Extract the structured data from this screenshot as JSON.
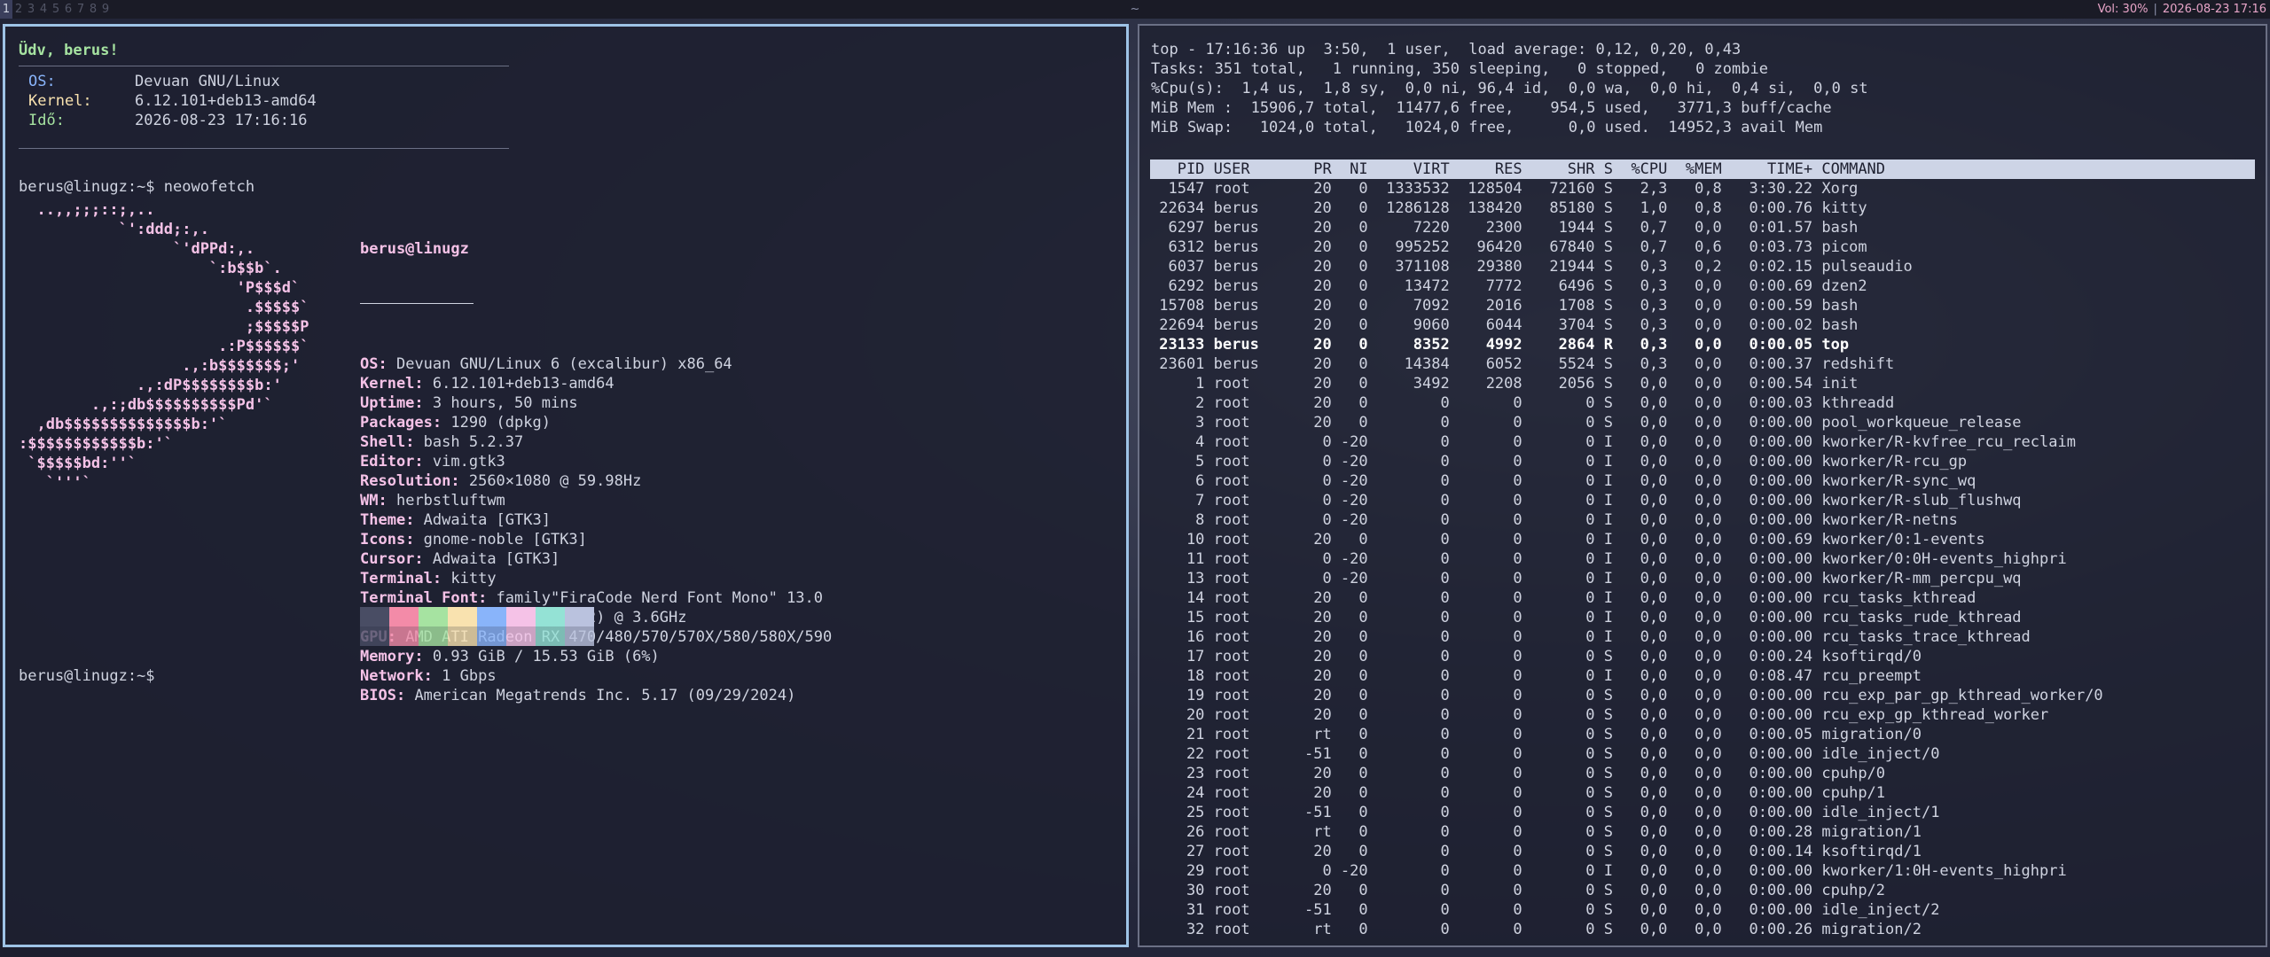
{
  "bar": {
    "tags": [
      "1",
      "2",
      "3",
      "4",
      "5",
      "6",
      "7",
      "8",
      "9"
    ],
    "active_tag": "1",
    "center": "~",
    "volume": "Vol: 30%",
    "separator": "|",
    "datetime": "2026-08-23 17:16"
  },
  "left": {
    "greeting": "Üdv, berus!",
    "sysinfo": [
      {
        "label": "OS:",
        "value": "Devuan GNU/Linux"
      },
      {
        "label": "Kernel:",
        "value": "6.12.101+deb13-amd64"
      },
      {
        "label": "Idő:",
        "value": "2026-08-23 17:16:16"
      }
    ],
    "prompt1": "berus@linugz:~$ neowofetch",
    "prompt2": "berus@linugz:~$",
    "ascii": "  ..,,;;;::;,..\n           `':ddd;:,.\n                 `'dPPd:,.\n                     `:b$$b`.\n                        'P$$$d`\n                         .$$$$$`\n                         ;$$$$$P\n                      .:P$$$$$$`\n                  .,:b$$$$$$$;'\n             .,:dP$$$$$$$$b:'\n        .,:;db$$$$$$$$$$Pd'`\n  ,db$$$$$$$$$$$$$$b:'`\n:$$$$$$$$$$$$b:'`\n `$$$$$bd:''`\n   `'''`",
    "neofetch": {
      "title": "berus@linugz",
      "fields": [
        {
          "key": "OS",
          "value": "Devuan GNU/Linux 6 (excalibur) x86_64"
        },
        {
          "key": "Kernel",
          "value": "6.12.101+deb13-amd64"
        },
        {
          "key": "Uptime",
          "value": "3 hours, 50 mins"
        },
        {
          "key": "Packages",
          "value": "1290 (dpkg)"
        },
        {
          "key": "Shell",
          "value": "bash 5.2.37"
        },
        {
          "key": "Editor",
          "value": "vim.gtk3"
        },
        {
          "key": "Resolution",
          "value": "2560×1080 @ 59.98Hz"
        },
        {
          "key": "WM",
          "value": "herbstluftwm"
        },
        {
          "key": "Theme",
          "value": "Adwaita [GTK3]"
        },
        {
          "key": "Icons",
          "value": "gnome-noble [GTK3]"
        },
        {
          "key": "Cursor",
          "value": "Adwaita [GTK3]"
        },
        {
          "key": "Terminal",
          "value": "kitty"
        },
        {
          "key": "Terminal Font",
          "value": "family\"FiraCode Nerd Font Mono\" 13.0"
        },
        {
          "key": "CPU",
          "value": "AMD Ryzen 5 1600X (12) @ 3.6GHz"
        },
        {
          "key": "GPU",
          "value": "AMD ATI Radeon RX 470/480/570/570X/580/580X/590"
        },
        {
          "key": "Memory",
          "value": "0.93 GiB / 15.53 GiB (6%)"
        },
        {
          "key": "Network",
          "value": "1 Gbps"
        },
        {
          "key": "BIOS",
          "value": "American Megatrends Inc. 5.17 (09/29/2024)"
        }
      ],
      "palette": [
        "#494d64",
        "#f38ba8",
        "#a6e3a1",
        "#f9e2af",
        "#89b4fa",
        "#f5c2e7",
        "#94e2d5",
        "#bac2de"
      ]
    }
  },
  "top": {
    "header_lines": [
      "top - 17:16:36 up  3:50,  1 user,  load average: 0,12, 0,20, 0,43",
      "Tasks: 351 total,   1 running, 350 sleeping,   0 stopped,   0 zombie",
      "%Cpu(s):  1,4 us,  1,8 sy,  0,0 ni, 96,4 id,  0,0 wa,  0,0 hi,  0,4 si,  0,0 st",
      "MiB Mem :  15906,7 total,  11477,6 free,    954,5 used,   3771,3 buff/cache",
      "MiB Swap:   1024,0 total,   1024,0 free,      0,0 used.  14952,3 avail Mem"
    ],
    "columns": [
      "PID",
      "USER",
      "PR",
      "NI",
      "VIRT",
      "RES",
      "SHR",
      "S",
      "%CPU",
      "%MEM",
      "TIME+",
      "COMMAND"
    ],
    "rows": [
      [
        "1547",
        "root",
        "20",
        "0",
        "1333532",
        "128504",
        "72160",
        "S",
        "2,3",
        "0,8",
        "3:30.22",
        "Xorg"
      ],
      [
        "22634",
        "berus",
        "20",
        "0",
        "1286128",
        "138420",
        "85180",
        "S",
        "1,0",
        "0,8",
        "0:00.76",
        "kitty"
      ],
      [
        "6297",
        "berus",
        "20",
        "0",
        "7220",
        "2300",
        "1944",
        "S",
        "0,7",
        "0,0",
        "0:01.57",
        "bash"
      ],
      [
        "6312",
        "berus",
        "20",
        "0",
        "995252",
        "96420",
        "67840",
        "S",
        "0,7",
        "0,6",
        "0:03.73",
        "picom"
      ],
      [
        "6037",
        "berus",
        "20",
        "0",
        "371108",
        "29380",
        "21944",
        "S",
        "0,3",
        "0,2",
        "0:02.15",
        "pulseaudio"
      ],
      [
        "6292",
        "berus",
        "20",
        "0",
        "13472",
        "7772",
        "6496",
        "S",
        "0,3",
        "0,0",
        "0:00.69",
        "dzen2"
      ],
      [
        "15708",
        "berus",
        "20",
        "0",
        "7092",
        "2016",
        "1708",
        "S",
        "0,3",
        "0,0",
        "0:00.59",
        "bash"
      ],
      [
        "22694",
        "berus",
        "20",
        "0",
        "9060",
        "6044",
        "3704",
        "S",
        "0,3",
        "0,0",
        "0:00.02",
        "bash"
      ],
      [
        "23133",
        "berus",
        "20",
        "0",
        "8352",
        "4992",
        "2864",
        "R",
        "0,3",
        "0,0",
        "0:00.05",
        "top"
      ],
      [
        "23601",
        "berus",
        "20",
        "0",
        "14384",
        "6052",
        "5524",
        "S",
        "0,3",
        "0,0",
        "0:00.37",
        "redshift"
      ],
      [
        "1",
        "root",
        "20",
        "0",
        "3492",
        "2208",
        "2056",
        "S",
        "0,0",
        "0,0",
        "0:00.54",
        "init"
      ],
      [
        "2",
        "root",
        "20",
        "0",
        "0",
        "0",
        "0",
        "S",
        "0,0",
        "0,0",
        "0:00.03",
        "kthreadd"
      ],
      [
        "3",
        "root",
        "20",
        "0",
        "0",
        "0",
        "0",
        "S",
        "0,0",
        "0,0",
        "0:00.00",
        "pool_workqueue_release"
      ],
      [
        "4",
        "root",
        "0",
        "-20",
        "0",
        "0",
        "0",
        "I",
        "0,0",
        "0,0",
        "0:00.00",
        "kworker/R-kvfree_rcu_reclaim"
      ],
      [
        "5",
        "root",
        "0",
        "-20",
        "0",
        "0",
        "0",
        "I",
        "0,0",
        "0,0",
        "0:00.00",
        "kworker/R-rcu_gp"
      ],
      [
        "6",
        "root",
        "0",
        "-20",
        "0",
        "0",
        "0",
        "I",
        "0,0",
        "0,0",
        "0:00.00",
        "kworker/R-sync_wq"
      ],
      [
        "7",
        "root",
        "0",
        "-20",
        "0",
        "0",
        "0",
        "I",
        "0,0",
        "0,0",
        "0:00.00",
        "kworker/R-slub_flushwq"
      ],
      [
        "8",
        "root",
        "0",
        "-20",
        "0",
        "0",
        "0",
        "I",
        "0,0",
        "0,0",
        "0:00.00",
        "kworker/R-netns"
      ],
      [
        "10",
        "root",
        "20",
        "0",
        "0",
        "0",
        "0",
        "I",
        "0,0",
        "0,0",
        "0:00.69",
        "kworker/0:1-events"
      ],
      [
        "11",
        "root",
        "0",
        "-20",
        "0",
        "0",
        "0",
        "I",
        "0,0",
        "0,0",
        "0:00.00",
        "kworker/0:0H-events_highpri"
      ],
      [
        "13",
        "root",
        "0",
        "-20",
        "0",
        "0",
        "0",
        "I",
        "0,0",
        "0,0",
        "0:00.00",
        "kworker/R-mm_percpu_wq"
      ],
      [
        "14",
        "root",
        "20",
        "0",
        "0",
        "0",
        "0",
        "I",
        "0,0",
        "0,0",
        "0:00.00",
        "rcu_tasks_kthread"
      ],
      [
        "15",
        "root",
        "20",
        "0",
        "0",
        "0",
        "0",
        "I",
        "0,0",
        "0,0",
        "0:00.00",
        "rcu_tasks_rude_kthread"
      ],
      [
        "16",
        "root",
        "20",
        "0",
        "0",
        "0",
        "0",
        "I",
        "0,0",
        "0,0",
        "0:00.00",
        "rcu_tasks_trace_kthread"
      ],
      [
        "17",
        "root",
        "20",
        "0",
        "0",
        "0",
        "0",
        "S",
        "0,0",
        "0,0",
        "0:00.24",
        "ksoftirqd/0"
      ],
      [
        "18",
        "root",
        "20",
        "0",
        "0",
        "0",
        "0",
        "I",
        "0,0",
        "0,0",
        "0:08.47",
        "rcu_preempt"
      ],
      [
        "19",
        "root",
        "20",
        "0",
        "0",
        "0",
        "0",
        "S",
        "0,0",
        "0,0",
        "0:00.00",
        "rcu_exp_par_gp_kthread_worker/0"
      ],
      [
        "20",
        "root",
        "20",
        "0",
        "0",
        "0",
        "0",
        "S",
        "0,0",
        "0,0",
        "0:00.00",
        "rcu_exp_gp_kthread_worker"
      ],
      [
        "21",
        "root",
        "rt",
        "0",
        "0",
        "0",
        "0",
        "S",
        "0,0",
        "0,0",
        "0:00.05",
        "migration/0"
      ],
      [
        "22",
        "root",
        "-51",
        "0",
        "0",
        "0",
        "0",
        "S",
        "0,0",
        "0,0",
        "0:00.00",
        "idle_inject/0"
      ],
      [
        "23",
        "root",
        "20",
        "0",
        "0",
        "0",
        "0",
        "S",
        "0,0",
        "0,0",
        "0:00.00",
        "cpuhp/0"
      ],
      [
        "24",
        "root",
        "20",
        "0",
        "0",
        "0",
        "0",
        "S",
        "0,0",
        "0,0",
        "0:00.00",
        "cpuhp/1"
      ],
      [
        "25",
        "root",
        "-51",
        "0",
        "0",
        "0",
        "0",
        "S",
        "0,0",
        "0,0",
        "0:00.00",
        "idle_inject/1"
      ],
      [
        "26",
        "root",
        "rt",
        "0",
        "0",
        "0",
        "0",
        "S",
        "0,0",
        "0,0",
        "0:00.28",
        "migration/1"
      ],
      [
        "27",
        "root",
        "20",
        "0",
        "0",
        "0",
        "0",
        "S",
        "0,0",
        "0,0",
        "0:00.14",
        "ksoftirqd/1"
      ],
      [
        "29",
        "root",
        "0",
        "-20",
        "0",
        "0",
        "0",
        "I",
        "0,0",
        "0,0",
        "0:00.00",
        "kworker/1:0H-events_highpri"
      ],
      [
        "30",
        "root",
        "20",
        "0",
        "0",
        "0",
        "0",
        "S",
        "0,0",
        "0,0",
        "0:00.00",
        "cpuhp/2"
      ],
      [
        "31",
        "root",
        "-51",
        "0",
        "0",
        "0",
        "0",
        "S",
        "0,0",
        "0,0",
        "0:00.00",
        "idle_inject/2"
      ],
      [
        "32",
        "root",
        "rt",
        "0",
        "0",
        "0",
        "0",
        "S",
        "0,0",
        "0,0",
        "0:00.26",
        "migration/2"
      ]
    ],
    "highlight_pid": "23133"
  }
}
